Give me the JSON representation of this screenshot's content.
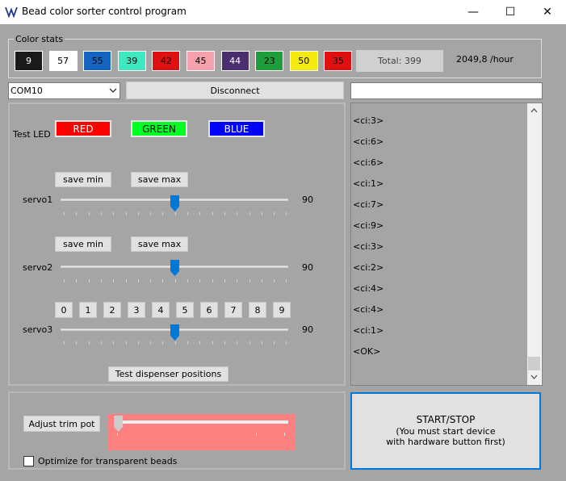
{
  "window": {
    "title": "Bead color sorter control program",
    "minimize": "—",
    "maximize": "☐",
    "close": "✕"
  },
  "color_stats": {
    "label": "Color stats",
    "boxes": [
      {
        "count": "9",
        "bg": "#1a1a1a",
        "fg": "#ffffff"
      },
      {
        "count": "57",
        "bg": "#ffffff",
        "fg": "#000000"
      },
      {
        "count": "55",
        "bg": "#1565c0",
        "fg": "#000000"
      },
      {
        "count": "39",
        "bg": "#3ee8c0",
        "fg": "#000000"
      },
      {
        "count": "42",
        "bg": "#e01010",
        "fg": "#000000"
      },
      {
        "count": "45",
        "bg": "#f7a0ae",
        "fg": "#000000"
      },
      {
        "count": "44",
        "bg": "#4a2e6e",
        "fg": "#ffffff"
      },
      {
        "count": "23",
        "bg": "#1e9e3a",
        "fg": "#000000"
      },
      {
        "count": "50",
        "bg": "#f5ea10",
        "fg": "#000000"
      },
      {
        "count": "35",
        "bg": "#e01010",
        "fg": "#000000"
      }
    ],
    "total": "Total: 399",
    "rate": "2049,8 /hour"
  },
  "connection": {
    "port": "COM10",
    "disconnect_label": "Disconnect",
    "command_input": ""
  },
  "test_led": {
    "label": "Test LED",
    "red": "RED",
    "green": "GREEN",
    "blue": "BLUE",
    "red_color": "#ff0000",
    "green_color": "#00ff22",
    "blue_color": "#0000ff"
  },
  "servo1": {
    "label": "servo1",
    "save_min": "save min",
    "save_max": "save max",
    "value": "90",
    "position": 0.5
  },
  "servo2": {
    "label": "servo2",
    "save_min": "save min",
    "save_max": "save max",
    "value": "90",
    "position": 0.5
  },
  "servo3": {
    "label": "servo3",
    "value": "90",
    "position": 0.5,
    "positions": [
      "0",
      "1",
      "2",
      "3",
      "4",
      "5",
      "6",
      "7",
      "8",
      "9"
    ]
  },
  "test_dispenser_label": "Test dispenser positions",
  "log": [
    "<ci:3>",
    "<ci:6>",
    "<ci:6>",
    "<ci:1>",
    "<ci:7>",
    "<ci:9>",
    "<ci:3>",
    "<ci:2>",
    "<ci:4>",
    "<ci:4>",
    "<ci:1>",
    "<OK>"
  ],
  "trim": {
    "adjust_label": "Adjust trim pot",
    "position": 0,
    "bg": "#fc8080"
  },
  "optimize_label": "Optimize for transparent beads",
  "start_stop": {
    "line1": "START/STOP",
    "line2": "(You must start device",
    "line3": "with hardware button first)"
  }
}
